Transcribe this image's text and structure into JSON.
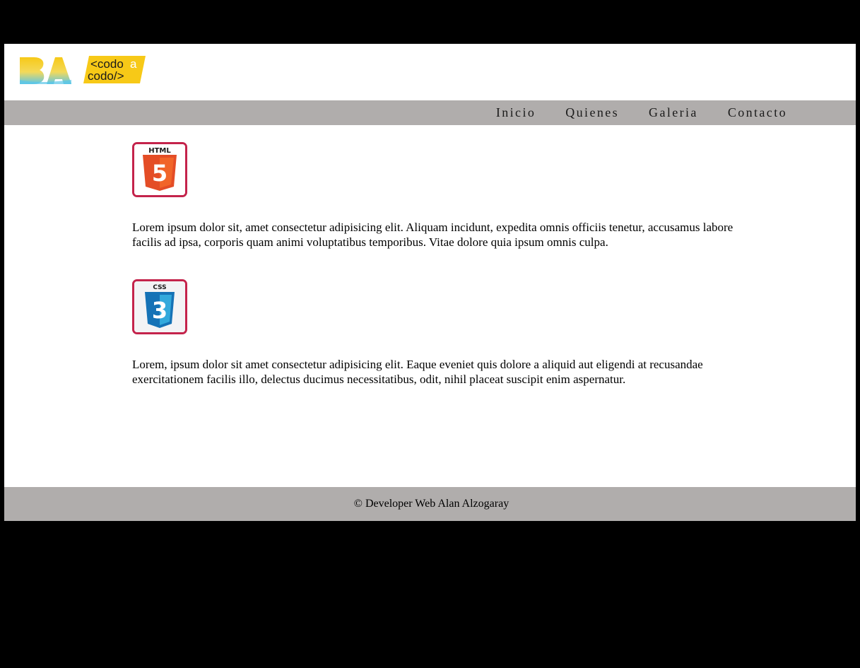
{
  "header": {
    "logo_ba_text": "BA",
    "logo_cac_line1": "<codo",
    "logo_cac_a": "a",
    "logo_cac_line2": "codo/>"
  },
  "nav": {
    "items": [
      {
        "label": "Inicio"
      },
      {
        "label": "Quienes"
      },
      {
        "label": "Galeria"
      },
      {
        "label": "Contacto"
      }
    ]
  },
  "main": {
    "sections": [
      {
        "icon": "html5-icon",
        "badge_label": "HTML",
        "badge_number": "5",
        "text": "Lorem ipsum dolor sit, amet consectetur adipisicing elit. Aliquam incidunt, expedita omnis officiis tenetur, accusamus labore facilis ad ipsa, corporis quam animi voluptatibus temporibus. Vitae dolore quia ipsum omnis culpa."
      },
      {
        "icon": "css3-icon",
        "badge_label": "CSS",
        "badge_number": "3",
        "text": "Lorem, ipsum dolor sit amet consectetur adipisicing elit. Eaque eveniet quis dolore a aliquid aut eligendi at recusandae exercitationem facilis illo, delectus ducimus necessitatibus, odit, nihil placeat suscipit enim aspernatur."
      }
    ]
  },
  "footer": {
    "text": "© Developer Web Alan Alzogaray"
  },
  "colors": {
    "background": "#000000",
    "bar": "#b0adac",
    "badge_border": "#c4234b",
    "html_orange": "#e44d26",
    "css_blue": "#1572b6",
    "logo_yellow": "#f7c917",
    "logo_blue": "#5bc6e8"
  }
}
